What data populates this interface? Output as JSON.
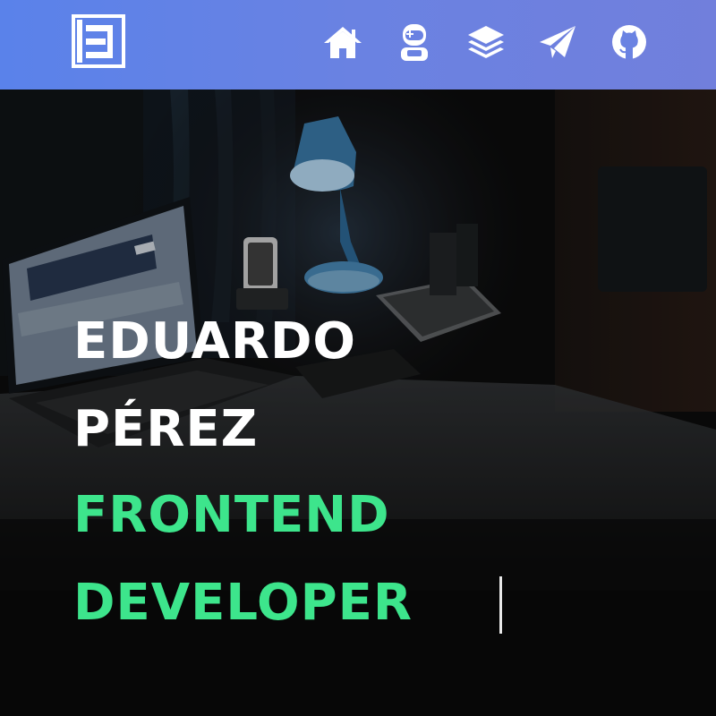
{
  "header": {
    "logo_icon": "bracket-e-logo",
    "nav_icons": [
      "home-icon",
      "astronaut-icon",
      "layers-icon",
      "paper-plane-icon",
      "github-icon"
    ],
    "colors": {
      "navbar_start": "#5a82ea",
      "navbar_end": "#717fdc",
      "icon": "#ffffff"
    }
  },
  "hero": {
    "name_line1": "EDUARDO",
    "name_line2": "PÉREZ",
    "role_line1": "FRONTEND",
    "role_line2": "DEVELOPER",
    "colors": {
      "name": "#ffffff",
      "role": "#3de58c"
    }
  }
}
